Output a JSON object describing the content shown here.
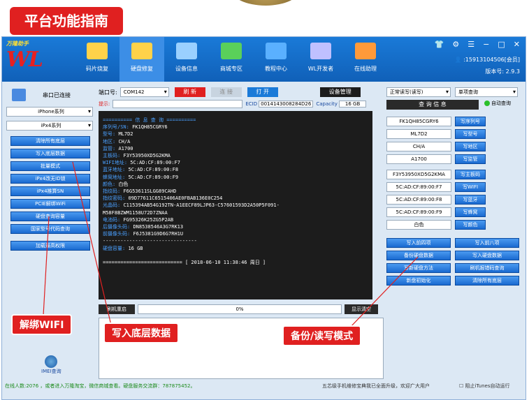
{
  "banner": "平台功能指南",
  "logo": {
    "tagline": "万隆助手",
    "brand": "WL"
  },
  "nav": [
    {
      "label": "码片烧复",
      "active": false
    },
    {
      "label": "硬盘修复",
      "active": true
    },
    {
      "label": "设备信息",
      "active": false
    },
    {
      "label": "商城专区",
      "active": false
    },
    {
      "label": "教程中心",
      "active": false
    },
    {
      "label": "WL开发者",
      "active": false
    },
    {
      "label": "在线助理",
      "active": false
    }
  ],
  "account": {
    "phone": ":15913104506[会员]",
    "version": "版本号: 2.9.3"
  },
  "left": {
    "port_status": "串口已连接",
    "model_series": "iPhone系列",
    "model": "iPx4系列",
    "buttons": [
      "清除所有底层",
      "写入底层数据",
      "批量模式",
      "iPx4改无ID锁",
      "iPx4推算SN",
      "PCIE解绑WiFi",
      "硬盘查询容量",
      "国家型号代码查询"
    ],
    "elevate": "加载最高权限",
    "imei": "IMEI查询"
  },
  "toolbar": {
    "port_label": "端口号:",
    "port_value": "COM142",
    "refresh": "刷 新",
    "connect": "连 接",
    "open": "打 开",
    "device_mgr": "设备管理",
    "hint_label": "提示:",
    "ecid_label": "ECID",
    "ecid_value": "0014143008284D26",
    "capacity_label": "Capacity",
    "capacity_value": "16 GB"
  },
  "terminal": {
    "header": "========== 信 息 查 询 ==========",
    "lines": [
      [
        "序列号/SN:",
        "FK1QH85CGRY6"
      ],
      [
        "型号:",
        "ML7D2"
      ],
      [
        "地区:",
        "CH/A"
      ],
      [
        "监管:",
        "A1700"
      ],
      [
        "主板码:",
        "F3Y53950XD5G2KMA"
      ],
      [
        "WIFI地址:",
        "5C:AD:CF:89:00:F7"
      ],
      [
        "蓝牙地址:",
        "5C:AD:CF:89:00:F8"
      ],
      [
        "蜂窝地址:",
        "5C:AD:CF:89:00:F9"
      ],
      [
        "颜色:",
        "白色"
      ],
      [
        "指纹码:",
        "F6G53611SLGG89CAHD"
      ],
      [
        "指纹密码:",
        "09D77611C6515406AE0FBAB136E0C254"
      ],
      [
        "光晶码:",
        "C115394AB54G192TN-A1EECF89LJP63-C57601593D2A50P5F091-"
      ],
      [
        "",
        "M58F8BZWM1158U72D7ZNAA"
      ],
      [
        "电池码:",
        "FG95326K25ZG5P2AB"
      ],
      [
        "后摄像头码:",
        "DN8538546A3G7RK13"
      ],
      [
        "前摄像头码:",
        "F6J5381G9D6G7RH1U"
      ],
      [
        "",
        "--------------------------------"
      ],
      [
        "硬盘容量:",
        "16 GB"
      ]
    ],
    "footer": "=========================== [ 2018-06-10 11:38:46 周日 ]"
  },
  "progress": {
    "restart": "刷机重启",
    "value": "0%",
    "clear": "显示清空"
  },
  "right": {
    "mode": "正常读写(读写)",
    "query_mode": "单项查询",
    "query_btn": "查 询 信 息",
    "auto_label": "自动查询",
    "fields": [
      {
        "value": "FK1QH85CGRY6",
        "btn": "写序列号"
      },
      {
        "value": "ML7D2",
        "btn": "写型号"
      },
      {
        "value": "CH/A",
        "btn": "写地区"
      },
      {
        "value": "A1700",
        "btn": "写监管"
      },
      {
        "value": "F3Y53950XD5G2KMA",
        "btn": "写主板码"
      },
      {
        "value": "5C:AD:CF:89:00:F7",
        "btn": "写WIFI"
      },
      {
        "value": "5C:AD:CF:89:00:F8",
        "btn": "写蓝牙"
      },
      {
        "value": "5C:AD:CF:89:00:F9",
        "btn": "写蜂窝"
      },
      {
        "value": "白色",
        "btn": "写颜色"
      }
    ],
    "grid": [
      "写入前四项",
      "写入前八项",
      "备份硬盘数据",
      "写入硬盘数据",
      "写新硬盘方法",
      "刷机报错码查询",
      "新盘初始化",
      "清除所有底层"
    ]
  },
  "callouts": {
    "wifi": "解绑WIFI",
    "write": "写入底层数据",
    "backup": "备份/读写模式"
  },
  "status": {
    "left": "在线人数:2076  ，或者进入万隆淘宝，微信商城查看。硬盘服务交流群：787875452。",
    "right": "五芯级手机维修宝典我已全面升级，欢迎广大用户",
    "itunes": "阻止iTunes自动运行"
  }
}
